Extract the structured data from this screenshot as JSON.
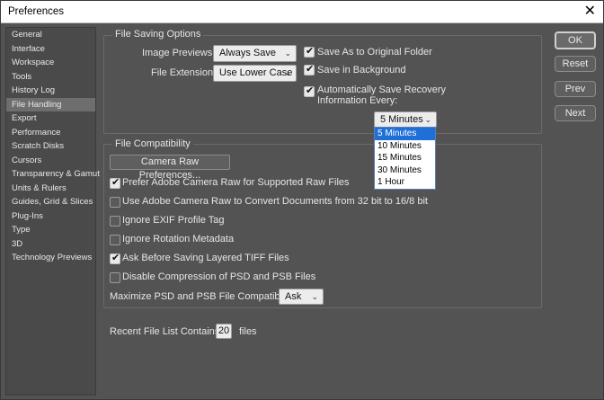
{
  "window": {
    "title": "Preferences",
    "close_glyph": "✕"
  },
  "sidebar": {
    "items": [
      {
        "label": "General"
      },
      {
        "label": "Interface"
      },
      {
        "label": "Workspace"
      },
      {
        "label": "Tools"
      },
      {
        "label": "History Log"
      },
      {
        "label": "File Handling",
        "selected": true
      },
      {
        "label": "Export"
      },
      {
        "label": "Performance"
      },
      {
        "label": "Scratch Disks"
      },
      {
        "label": "Cursors"
      },
      {
        "label": "Transparency & Gamut"
      },
      {
        "label": "Units & Rulers"
      },
      {
        "label": "Guides, Grid & Slices"
      },
      {
        "label": "Plug-Ins"
      },
      {
        "label": "Type"
      },
      {
        "label": "3D"
      },
      {
        "label": "Technology Previews"
      }
    ]
  },
  "file_saving": {
    "title": "File Saving Options",
    "image_previews_label": "Image Previews:",
    "image_previews_value": "Always Save",
    "file_extension_label": "File Extension:",
    "file_extension_value": "Use Lower Case",
    "save_as_original": {
      "label": "Save As to Original Folder",
      "checked": true
    },
    "save_in_background": {
      "label": "Save in Background",
      "checked": true
    },
    "auto_save": {
      "label_line1": "Automatically Save Recovery",
      "label_line2": "Information Every:",
      "checked": true
    },
    "interval_value": "5 Minutes",
    "interval_options": [
      "5 Minutes",
      "10 Minutes",
      "15 Minutes",
      "30 Minutes",
      "1 Hour"
    ]
  },
  "file_compat": {
    "title": "File Compatibility",
    "camera_raw_button": "Camera Raw Preferences...",
    "options": [
      {
        "label": "Prefer Adobe Camera Raw for Supported Raw Files",
        "checked": true
      },
      {
        "label": "Use Adobe Camera Raw to Convert Documents from 32 bit to 16/8 bit",
        "checked": false
      },
      {
        "label": "Ignore EXIF Profile Tag",
        "checked": false
      },
      {
        "label": "Ignore Rotation Metadata",
        "checked": false
      },
      {
        "label": "Ask Before Saving Layered TIFF Files",
        "checked": true
      },
      {
        "label": "Disable Compression of PSD and PSB Files",
        "checked": false
      }
    ],
    "maximize_label": "Maximize PSD and PSB File Compatibility:",
    "maximize_value": "Ask"
  },
  "recent": {
    "label": "Recent File List Contains:",
    "value": "20",
    "suffix": "files"
  },
  "buttons": {
    "ok": "OK",
    "reset": "Reset",
    "prev": "Prev",
    "next": "Next"
  },
  "icons": {
    "chevron": "⌄",
    "check": "✔"
  }
}
